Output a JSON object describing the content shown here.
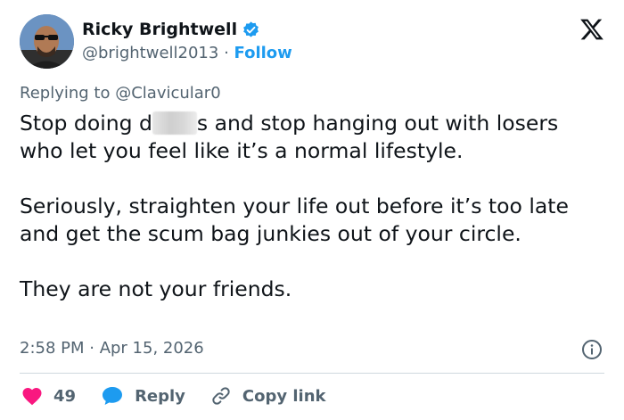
{
  "author": {
    "name": "Ricky Brightwell",
    "handle": "@brightwell2013",
    "separator": "·",
    "follow_label": "Follow"
  },
  "reply_context": {
    "prefix": "Replying to",
    "mention": "@Clavicular0"
  },
  "tweet": {
    "line1_a": "Stop doing d",
    "line1_b": "s and stop hanging out with losers who let you feel like it’s a normal lifestyle.",
    "paragraph2": "Seriously, straighten your life out before it’s too late and get the scum bag junkies out of your circle.",
    "paragraph3": "They are not your friends."
  },
  "meta": {
    "timestamp": "2:58 PM · Apr 15, 2026"
  },
  "actions": {
    "like_count": "49",
    "reply_label": "Reply",
    "copy_label": "Copy link"
  },
  "icons": {
    "verified": "verified-badge-icon",
    "platform": "x-logo-icon",
    "info": "info-icon",
    "like": "heart-icon",
    "reply": "speech-bubble-icon",
    "copy": "link-icon"
  },
  "colors": {
    "accent": "#1d9bf0",
    "like": "#f91880",
    "text": "#0f1419",
    "muted": "#536471"
  }
}
